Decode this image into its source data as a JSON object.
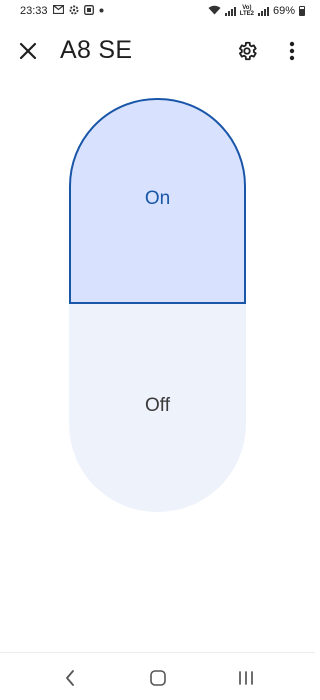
{
  "status_bar": {
    "time": "23:33",
    "battery": "69%",
    "left_icons": [
      "gmail-icon",
      "settings-notification-icon",
      "app-notification-icon",
      "dot-icon"
    ],
    "right_icons": [
      "wifi-icon",
      "signal-icon",
      "volte-icon",
      "signal-icon",
      "battery-icon"
    ],
    "volte_line1": "Vo)",
    "volte_line2": "LTE2"
  },
  "app_bar": {
    "title": "A8 SE",
    "close_icon": "close-icon",
    "settings_icon": "gear-icon",
    "more_icon": "more-vert-icon"
  },
  "power_switch": {
    "on_label": "On",
    "off_label": "Off",
    "selected": "On",
    "colors": {
      "selected_fill": "#d8e2ff",
      "selected_border": "#1a56a8",
      "unselected_fill": "#eef2fb"
    }
  },
  "nav_bar": {
    "buttons": [
      "back-icon",
      "home-icon",
      "recents-icon"
    ]
  }
}
